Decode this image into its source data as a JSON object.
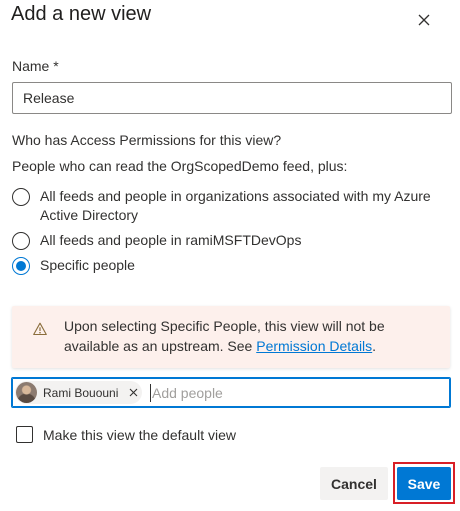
{
  "dialog": {
    "title": "Add a new view",
    "close_icon": "close-icon"
  },
  "name_field": {
    "label": "Name *",
    "value": "Release"
  },
  "permissions": {
    "question": "Who has Access Permissions for this view?",
    "subtitle": "People who can read the OrgScopedDemo feed, plus:",
    "options": [
      {
        "label": "All feeds and people in organizations associated with my Azure Active Directory",
        "selected": false
      },
      {
        "label": "All feeds and people in ramiMSFTDevOps",
        "selected": false
      },
      {
        "label": "Specific people",
        "selected": true
      }
    ]
  },
  "warning": {
    "icon": "warning-icon",
    "text": "Upon selecting Specific People, this view will not be available as an upstream. See ",
    "link_text": "Permission Details",
    "suffix": "."
  },
  "people_picker": {
    "selected_person": "Rami Bououni",
    "placeholder": "Add people"
  },
  "default_view": {
    "label": "Make this view the default view",
    "checked": false
  },
  "buttons": {
    "cancel": "Cancel",
    "save": "Save"
  },
  "colors": {
    "primary": "#0078d4",
    "warning_bg": "#fdf0ec",
    "highlight": "#d81f26"
  }
}
